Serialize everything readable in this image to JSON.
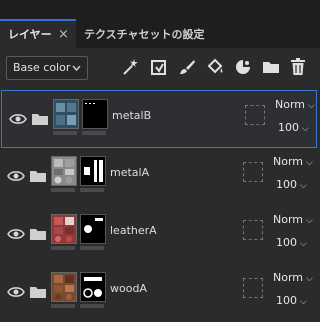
{
  "tabs": {
    "layers_label": "レイヤー",
    "close_glyph": "×",
    "texture_set_label": "テクスチャセットの設定"
  },
  "toolbar": {
    "channel_dropdown": {
      "value": "Base color",
      "chevron": "⌵"
    },
    "tools": [
      "magic-wand-icon",
      "add-effect-icon",
      "paint-brush-icon",
      "fill-bucket-icon",
      "smart-material-icon",
      "folder-icon",
      "trash-icon"
    ]
  },
  "layers": [
    {
      "name": "metalB",
      "blend": "Norm",
      "opacity": "100",
      "selected": true,
      "thumb": "metal-b"
    },
    {
      "name": "metalA",
      "blend": "Norm",
      "opacity": "100",
      "selected": false,
      "thumb": "metal-a"
    },
    {
      "name": "leatherA",
      "blend": "Norm",
      "opacity": "100",
      "selected": false,
      "thumb": "leather-a"
    },
    {
      "name": "woodA",
      "blend": "Norm",
      "opacity": "100",
      "selected": false,
      "thumb": "wood-a"
    }
  ],
  "colors": {
    "accent": "#2f6fdc",
    "panel_bg": "#2b2b2b",
    "tabbar_bg": "#1e1e1e"
  }
}
